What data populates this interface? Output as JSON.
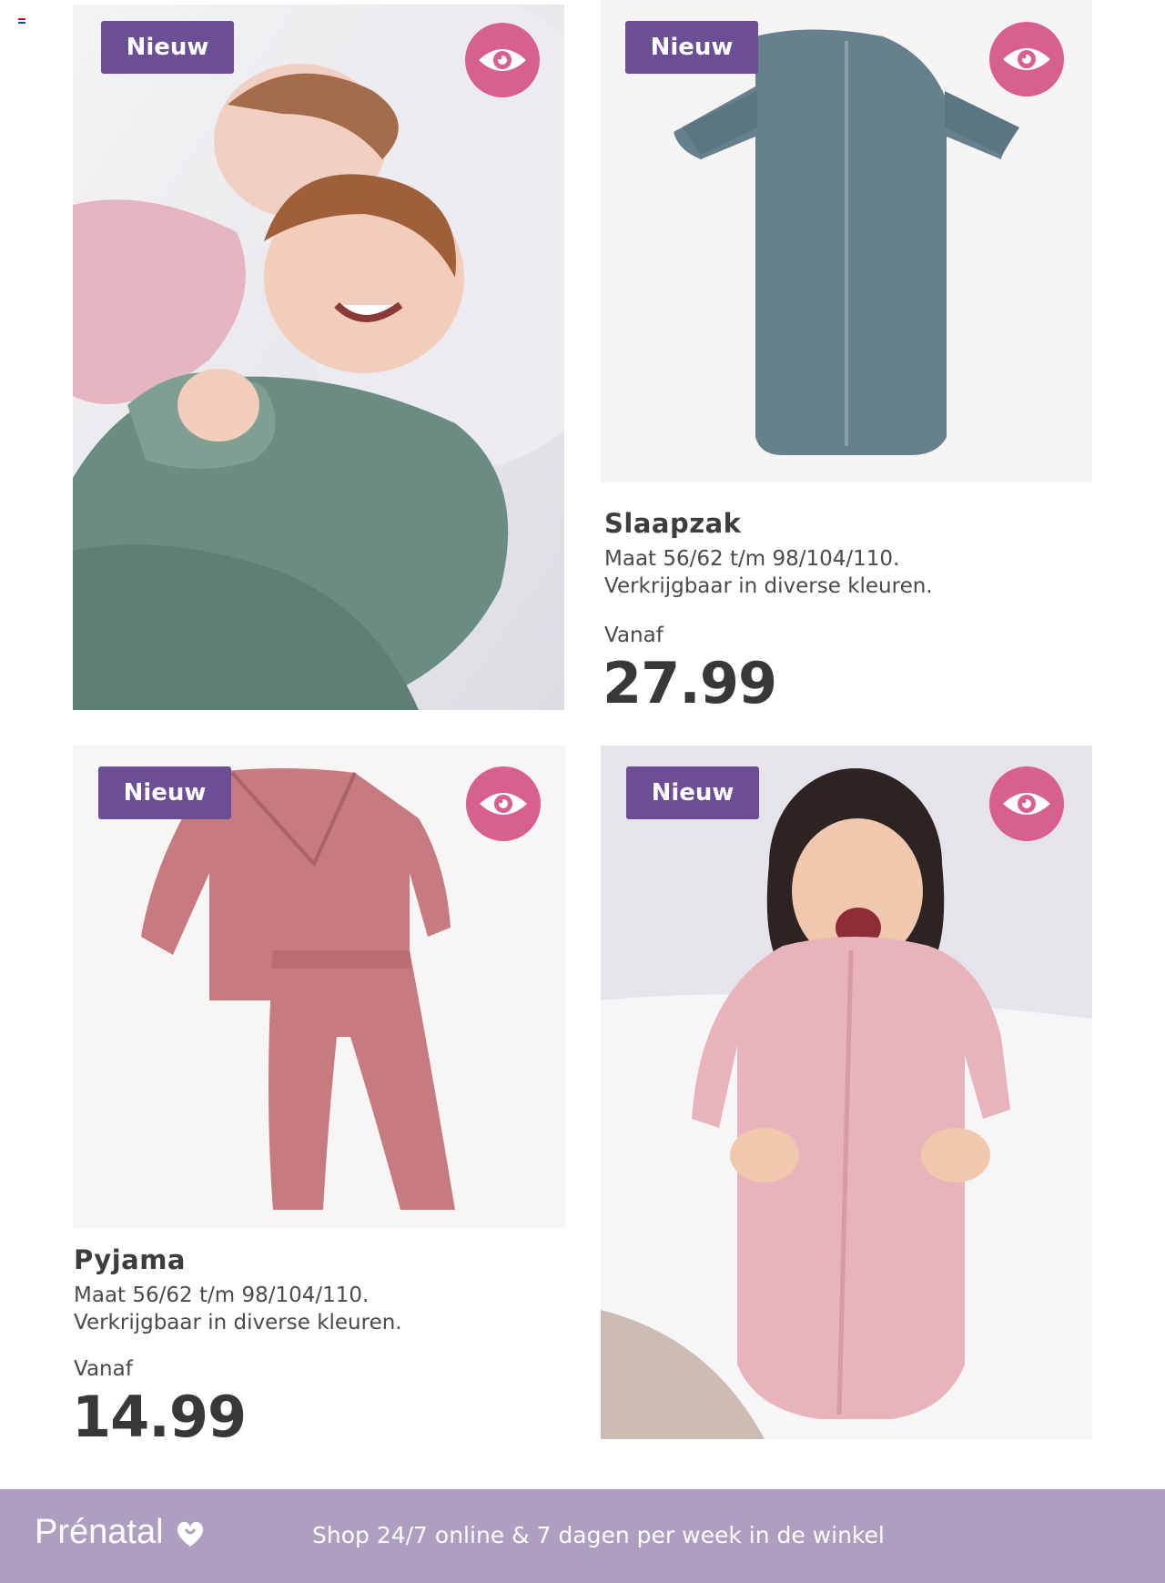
{
  "badges": {
    "new_label": "Nieuw"
  },
  "products": [
    {
      "title": "Slaapzak",
      "desc_line1": "Maat 56/62 t/m 98/104/110.",
      "desc_line2": "Verkrijgbaar in diverse kleuren.",
      "from_label": "Vanaf",
      "price": "27.99"
    },
    {
      "title": "Pyjama",
      "desc_line1": "Maat 56/62 t/m 98/104/110.",
      "desc_line2": "Verkrijgbaar in diverse kleuren.",
      "from_label": "Vanaf",
      "price": "14.99"
    }
  ],
  "footer": {
    "brand": "Prénatal",
    "slogan": "Shop 24/7 online & 7 dagen per week in de winkel"
  },
  "icons": [
    "eye-icon",
    "heart-logo-icon",
    "flag-icon"
  ],
  "colors": {
    "badge": "#6b4e96",
    "eye": "#d8608e",
    "footer": "#ae9fc1"
  }
}
